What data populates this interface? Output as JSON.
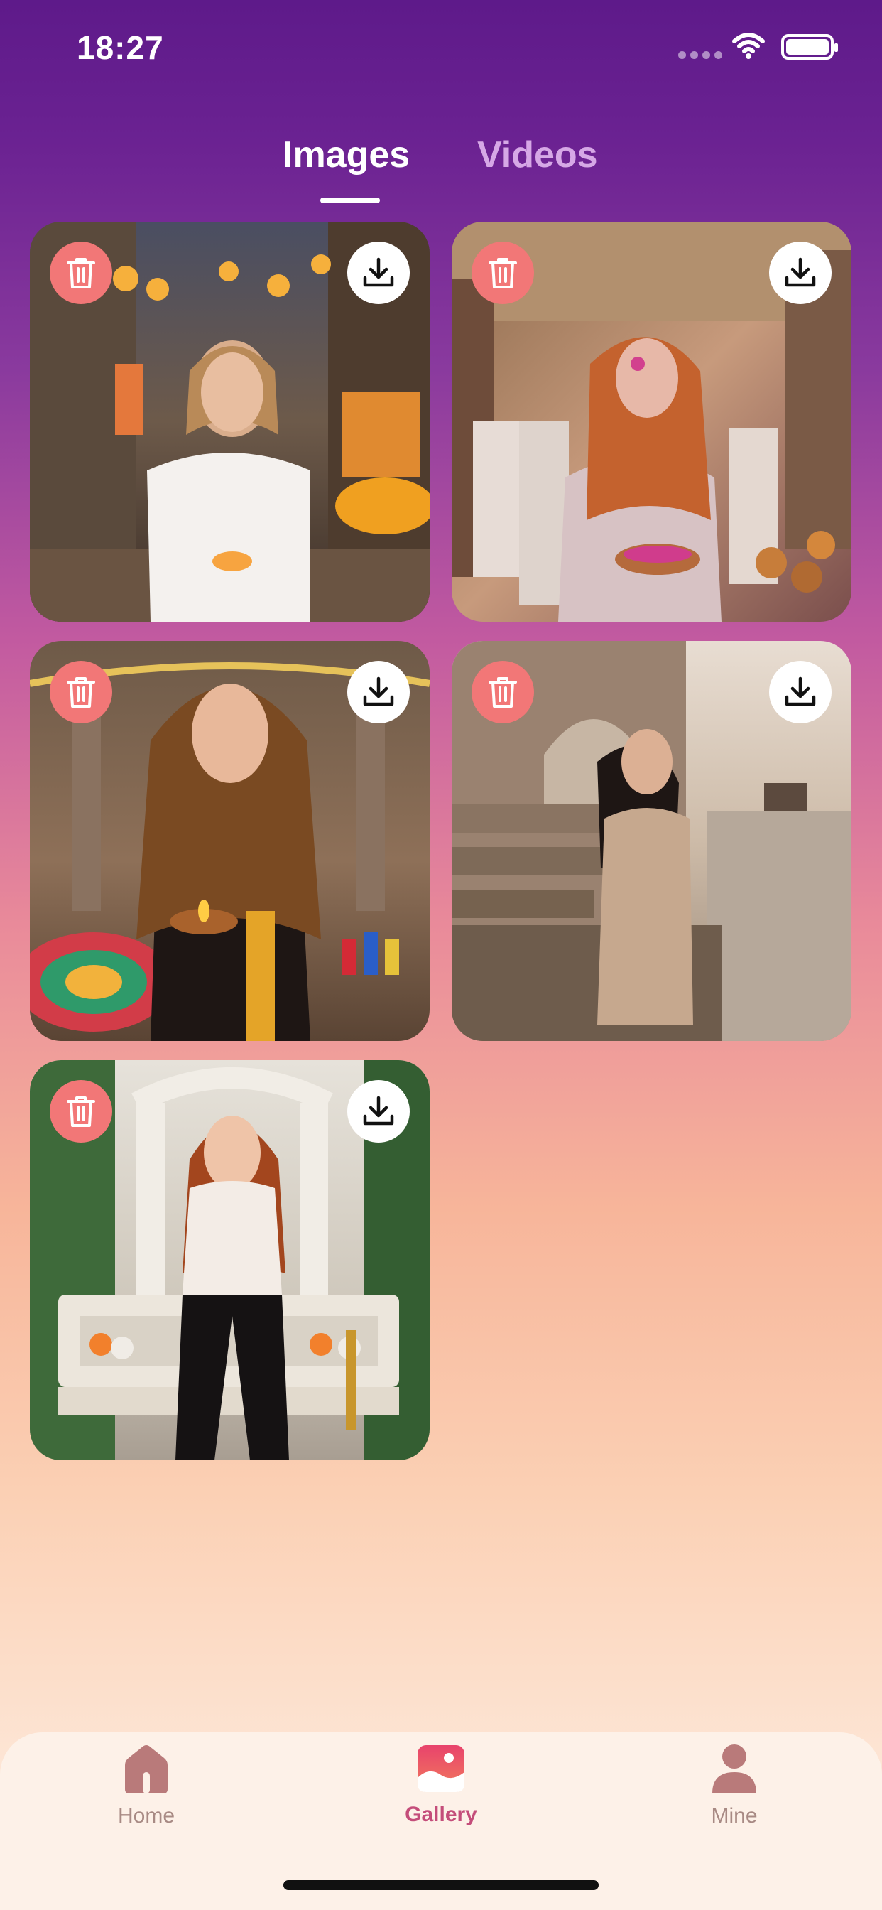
{
  "status_bar": {
    "time": "18:27"
  },
  "tabs": [
    {
      "label": "Images",
      "selected": true
    },
    {
      "label": "Videos",
      "selected": false
    }
  ],
  "gallery": {
    "items": [
      {
        "scene": "woman in white hoodie holding a diya in a lantern-lit market street"
      },
      {
        "scene": "woman with colored powder during Holi celebration in an old street"
      },
      {
        "scene": "woman with long hair holding a diya and marigold garland beside rangoli"
      },
      {
        "scene": "woman in beige outfit standing on river ghats"
      },
      {
        "scene": "woman in white turtleneck sitting on carved bench with marigolds"
      }
    ]
  },
  "bottom_nav": {
    "items": [
      {
        "label": "Home",
        "icon": "home-icon",
        "active": false
      },
      {
        "label": "Gallery",
        "icon": "gallery-icon",
        "active": true
      },
      {
        "label": "Mine",
        "icon": "person-icon",
        "active": false
      }
    ]
  },
  "colors": {
    "accent": "#c44d7a",
    "delete": "#f27777",
    "tab_inactive": "#d6a8e6",
    "nav_inactive": "#a88a84"
  }
}
